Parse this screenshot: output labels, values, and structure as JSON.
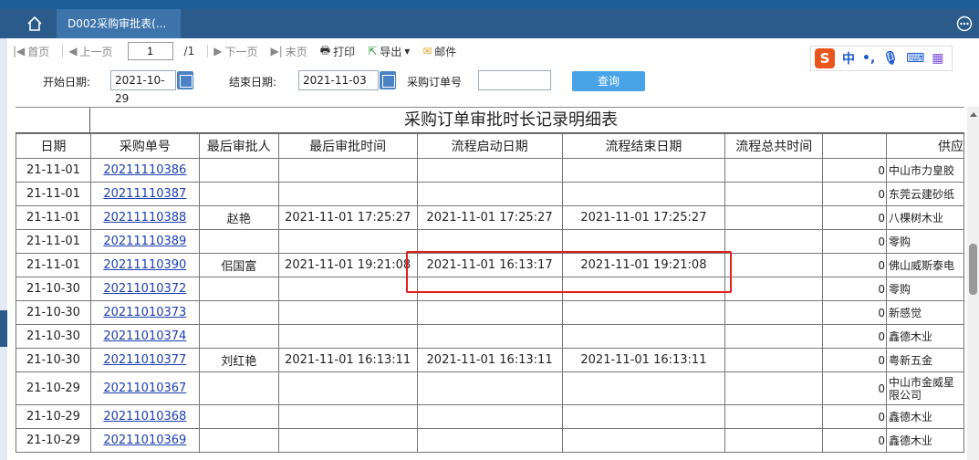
{
  "tab": {
    "title": "D002采购审批表(..."
  },
  "toolbar": {
    "first": "首页",
    "prev": "上一页",
    "page_value": "1",
    "page_total": "/1",
    "next": "下一页",
    "last": "末页",
    "print": "打印",
    "export": "导出",
    "mail": "邮件"
  },
  "ime": {
    "logo": "S",
    "mode": "中",
    "punct": "•,"
  },
  "filter": {
    "start_label": "开始日期:",
    "start_value": "2021-10-29",
    "end_label": "结束日期:",
    "end_value": "2021-11-03",
    "po_label": "采购订单号",
    "po_value": "",
    "query": "查询"
  },
  "report": {
    "title": "采购订单审批时长记录明细表",
    "headers": [
      "日期",
      "采购单号",
      "最后审批人",
      "最后审批时间",
      "流程启动日期",
      "流程结束日期",
      "流程总共时间",
      "",
      "供应"
    ],
    "rows": [
      {
        "date": "21-11-01",
        "po": "20211110386",
        "approver": "",
        "approve_time": "",
        "start": "",
        "end": "",
        "total": "",
        "num": "0",
        "supplier": "中山市力皇胶"
      },
      {
        "date": "21-11-01",
        "po": "20211110387",
        "approver": "",
        "approve_time": "",
        "start": "",
        "end": "",
        "total": "",
        "num": "0",
        "supplier": "东莞云建砂纸"
      },
      {
        "date": "21-11-01",
        "po": "20211110388",
        "approver": "赵艳",
        "approve_time": "2021-11-01 17:25:27",
        "start": "2021-11-01 17:25:27",
        "end": "2021-11-01 17:25:27",
        "total": "",
        "num": "0",
        "supplier": "八棵树木业"
      },
      {
        "date": "21-11-01",
        "po": "20211110389",
        "approver": "",
        "approve_time": "",
        "start": "",
        "end": "",
        "total": "",
        "num": "0",
        "supplier": "零购"
      },
      {
        "date": "21-11-01",
        "po": "20211110390",
        "approver": "佀国富",
        "approve_time": "2021-11-01 19:21:08",
        "start": "2021-11-01 16:13:17",
        "end": "2021-11-01 19:21:08",
        "total": "",
        "num": "0",
        "supplier": "佛山威斯泰电"
      },
      {
        "date": "21-10-30",
        "po": "20211010372",
        "approver": "",
        "approve_time": "",
        "start": "",
        "end": "",
        "total": "",
        "num": "0",
        "supplier": "零购"
      },
      {
        "date": "21-10-30",
        "po": "20211010373",
        "approver": "",
        "approve_time": "",
        "start": "",
        "end": "",
        "total": "",
        "num": "0",
        "supplier": "新感觉"
      },
      {
        "date": "21-10-30",
        "po": "20211010374",
        "approver": "",
        "approve_time": "",
        "start": "",
        "end": "",
        "total": "",
        "num": "0",
        "supplier": "鑫德木业"
      },
      {
        "date": "21-10-30",
        "po": "20211010377",
        "approver": "刘红艳",
        "approve_time": "2021-11-01 16:13:11",
        "start": "2021-11-01 16:13:11",
        "end": "2021-11-01 16:13:11",
        "total": "",
        "num": "0",
        "supplier": "粤新五金"
      },
      {
        "date": "21-10-29",
        "po": "20211010367",
        "approver": "",
        "approve_time": "",
        "start": "",
        "end": "",
        "total": "",
        "num": "0",
        "supplier": "中山市金威星限公司"
      },
      {
        "date": "21-10-29",
        "po": "20211010368",
        "approver": "",
        "approve_time": "",
        "start": "",
        "end": "",
        "total": "",
        "num": "0",
        "supplier": "鑫德木业"
      },
      {
        "date": "21-10-29",
        "po": "20211010369",
        "approver": "",
        "approve_time": "",
        "start": "",
        "end": "",
        "total": "",
        "num": "0",
        "supplier": "鑫德木业"
      }
    ]
  },
  "colors": {
    "tabbar": "#2b5b8a",
    "tab_active": "#3c74ab",
    "query_button": "#4aa3e6",
    "highlight": "#e02020",
    "link": "#1a3fb0"
  },
  "icons": [
    "home-icon",
    "more-icon",
    "first-page-icon",
    "prev-page-icon",
    "next-page-icon",
    "last-page-icon",
    "print-icon",
    "export-icon",
    "mail-icon",
    "calendar-icon",
    "mic-icon",
    "keyboard-icon",
    "grid-icon"
  ]
}
